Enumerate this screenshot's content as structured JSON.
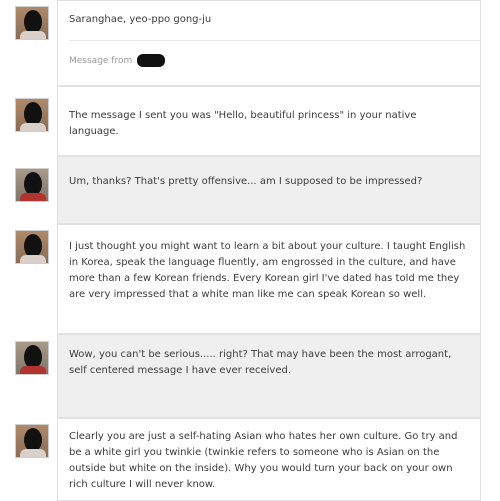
{
  "messages": [
    {
      "sender": "him",
      "text": "Saranghae, yeo-ppo gong-ju",
      "meta": "Message from"
    },
    {
      "sender": "him",
      "text": "The message I sent you was \"Hello, beautiful princess\" in your native language."
    },
    {
      "sender": "her",
      "text": "Um, thanks? That's pretty offensive... am I supposed to be impressed?"
    },
    {
      "sender": "him",
      "text": "I just thought you might want to learn a bit about your culture. I taught English in Korea, speak the language fluently, am engrossed in the culture, and have more than a few Korean friends. Every Korean girl I've dated has told me they are very impressed that a white man like me can speak Korean so well."
    },
    {
      "sender": "her",
      "text": "Wow, you can't be serious..... right? That may have been the most arrogant, self centered message I have ever received."
    },
    {
      "sender": "him",
      "text": "Clearly you are just a self-hating Asian who hates her own culture. Go try and be a white girl you twinkie (twinkie refers to someone who is Asian on the outside but white on the inside). Why you would turn your back on your own rich culture I will never know."
    }
  ]
}
